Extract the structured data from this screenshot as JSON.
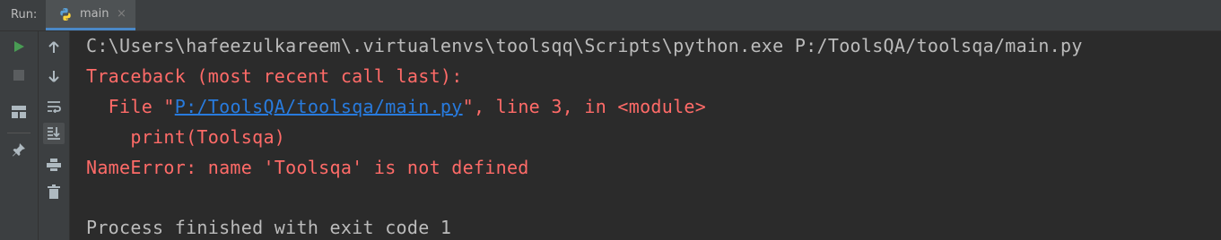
{
  "run_label": "Run:",
  "tab": {
    "label": "main",
    "close": "×",
    "icon": "python-icon"
  },
  "console": {
    "command": "C:\\Users\\hafeezulkareem\\.virtualenvs\\toolsqq\\Scripts\\python.exe P:/ToolsQA/toolsqa/main.py",
    "traceback_header": "Traceback (most recent call last):",
    "file_prefix": "  File \"",
    "file_link": "P:/ToolsQA/toolsqa/main.py",
    "file_suffix": "\", line 3, in <module>",
    "code_line": "    print(Toolsqa)",
    "error": "NameError: name 'Toolsqa' is not defined",
    "exit_message": "Process finished with exit code 1"
  },
  "colors": {
    "background": "#2b2b2b",
    "toolbar": "#3c3f41",
    "output_text": "#bbbbbb",
    "error_text": "#ff6b68",
    "link": "#287bde",
    "run_green": "#499c54"
  }
}
